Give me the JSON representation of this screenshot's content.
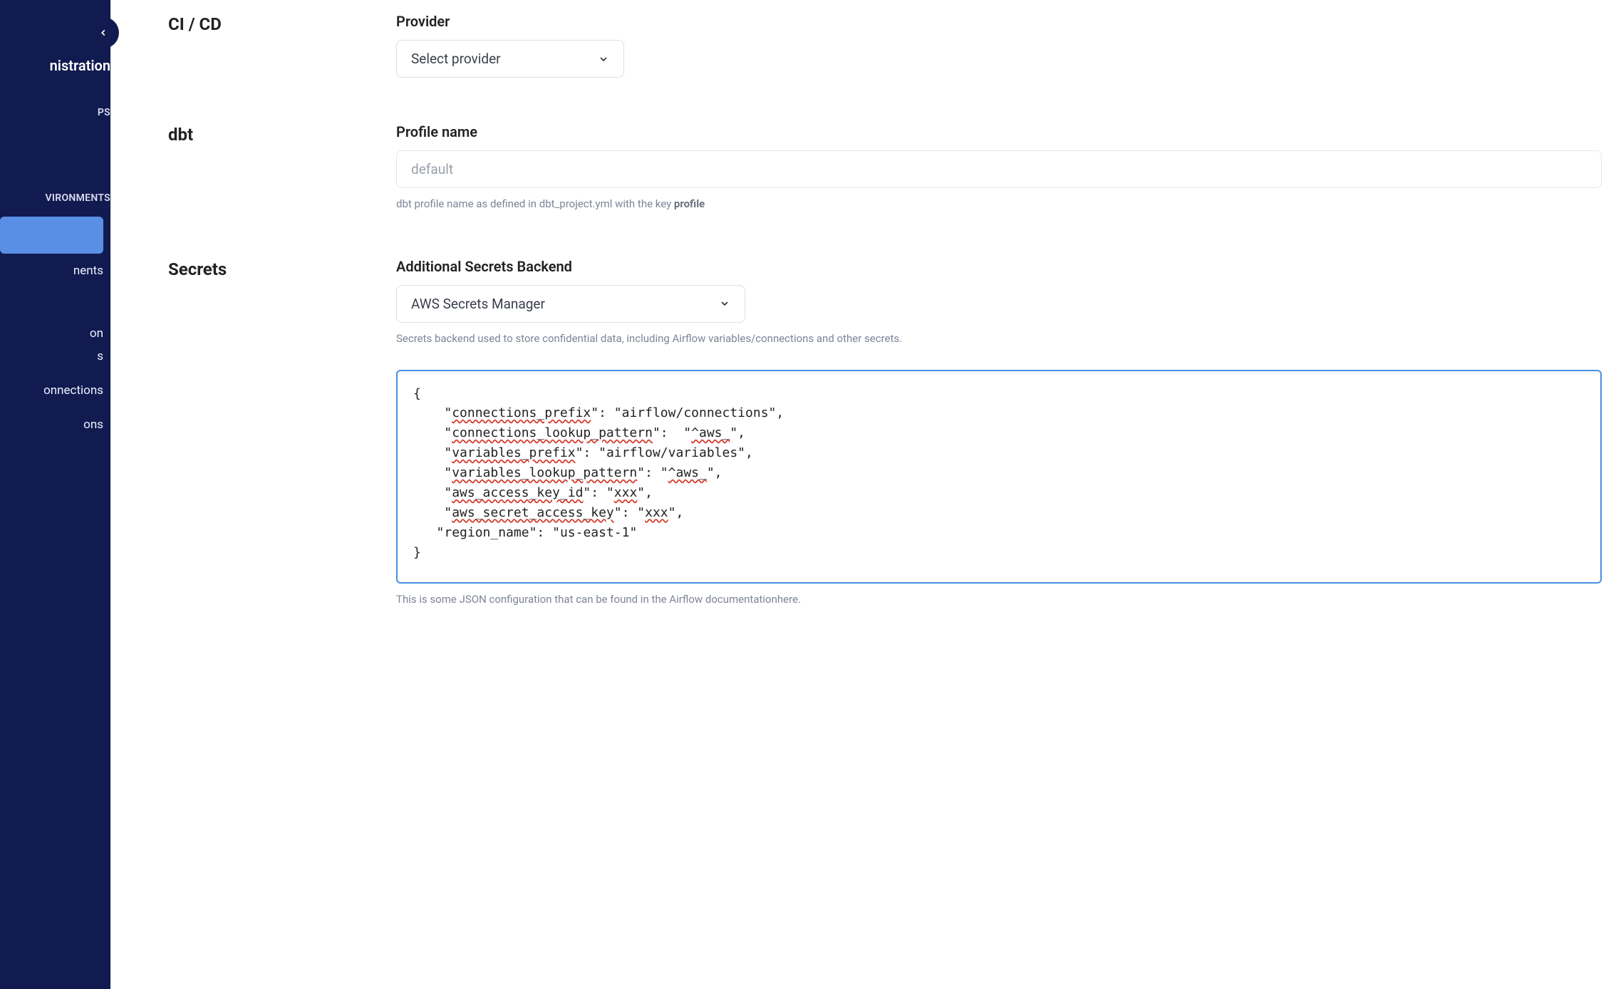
{
  "sidebar": {
    "heading": "nistration",
    "section1_label": "PS",
    "section2_label": "VIRONMENTS",
    "item_active": "",
    "item_environments": "nents",
    "item_on": "on",
    "item_s": "s",
    "item_connections": "onnections",
    "item_ons": "ons"
  },
  "main": {
    "cicd": {
      "label": "CI / CD",
      "provider_label": "Provider",
      "provider_placeholder": "Select provider"
    },
    "dbt": {
      "label": "dbt",
      "profile_label": "Profile name",
      "profile_placeholder": "default",
      "profile_help_prefix": "dbt profile name as defined in dbt_project.yml with the key ",
      "profile_help_bold": "profile"
    },
    "secrets": {
      "label": "Secrets",
      "backend_label": "Additional Secrets Backend",
      "backend_value": "AWS Secrets Manager",
      "backend_help": "Secrets backend used to store confidential data, including Airflow variables/connections and other secrets.",
      "json_k1": "connections_prefix",
      "json_v1": "airflow/connections",
      "json_k2": "connections_lookup_pattern",
      "json_v2": "^aws_",
      "json_k3": "variables_prefix",
      "json_v3": "airflow/variables",
      "json_k4": "variables_lookup_pattern",
      "json_v4": "^aws_",
      "json_k5": "aws_access_key_id",
      "json_v5": "xxx",
      "json_k6": "aws_secret_access_key",
      "json_v6": "xxx",
      "json_k7": "region_name",
      "json_v7": "us-east-1",
      "json_help": "This is some JSON configuration that can be found in the Airflow documentationhere."
    }
  }
}
